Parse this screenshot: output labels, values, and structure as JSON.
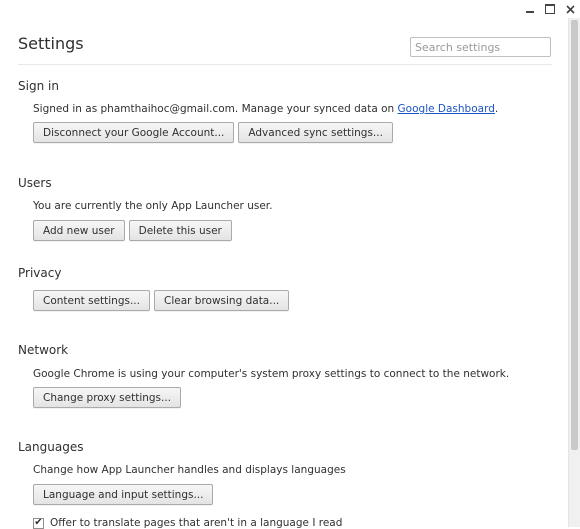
{
  "window": {
    "minimize_label": "–",
    "maximize_label": "☐",
    "close_label": "✕"
  },
  "header": {
    "title": "Settings",
    "search_placeholder": "Search settings"
  },
  "sign_in": {
    "title": "Sign in",
    "status_prefix": "Signed in as phamthaihoc@gmail.com. Manage your synced data on ",
    "dashboard_link": "Google Dashboard",
    "status_suffix": ".",
    "disconnect_button": "Disconnect your Google Account...",
    "advanced_sync_button": "Advanced sync settings..."
  },
  "users": {
    "title": "Users",
    "description": "You are currently the only App Launcher user.",
    "add_button": "Add new user",
    "delete_button": "Delete this user"
  },
  "privacy": {
    "title": "Privacy",
    "content_settings_button": "Content settings...",
    "clear_data_button": "Clear browsing data..."
  },
  "network": {
    "title": "Network",
    "description": "Google Chrome is using your computer's system proxy settings to connect to the network.",
    "proxy_button": "Change proxy settings..."
  },
  "languages": {
    "title": "Languages",
    "description": "Change how App Launcher handles and displays languages",
    "input_settings_button": "Language and input settings...",
    "translate_checkbox_label": "Offer to translate pages that aren't in a language I read",
    "translate_checked": true
  }
}
